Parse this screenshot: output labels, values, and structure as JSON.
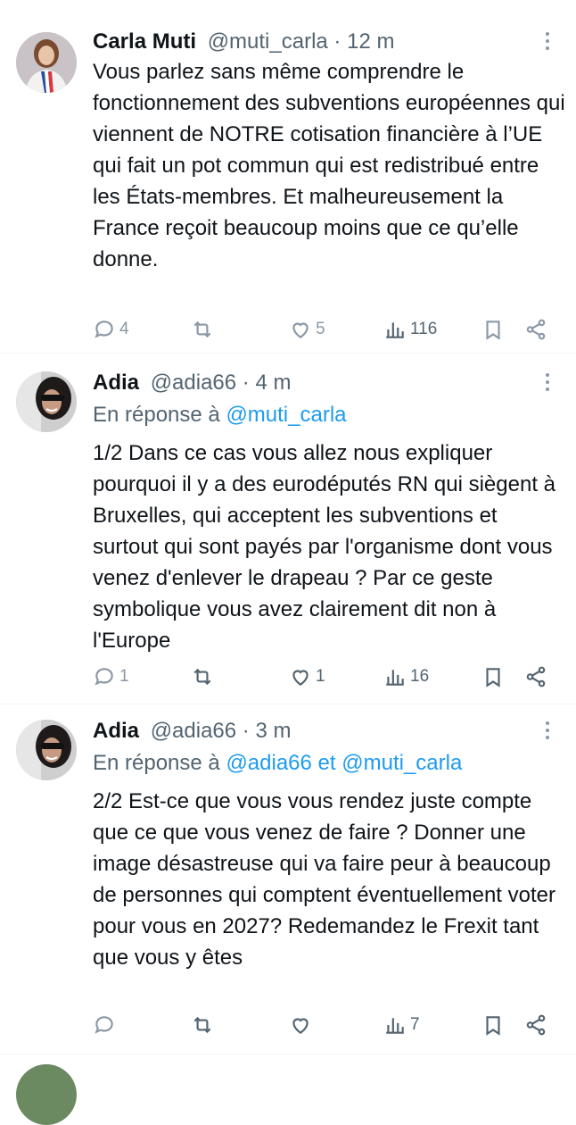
{
  "tweets": [
    {
      "name": "Carla Muti",
      "handle": "@muti_carla",
      "time": "12 m",
      "reply_prefix": "",
      "reply_links": [],
      "text": "Vous parlez sans même comprendre le fonctionnement des subventions européennes qui viennent de NOTRE cotisation financière à l’UE qui fait un pot commun qui est redistribué entre les États-membres. Et malheureusement la France reçoit beaucoup moins que ce qu’elle donne.",
      "replies": "4",
      "retweets": "",
      "likes": "5",
      "views": "116"
    },
    {
      "name": "Adia",
      "handle": "@adia66",
      "time": "4 m",
      "reply_prefix": "En réponse à ",
      "reply_links": [
        "@muti_carla"
      ],
      "text": "1/2 Dans ce cas vous allez nous expliquer pourquoi il y a des eurodéputés RN  qui siègent à Bruxelles, qui acceptent les subventions et surtout qui sont payés par l'organisme dont vous venez d'enlever le drapeau ? Par ce geste symbolique vous avez clairement dit non à l'Europe",
      "replies": "1",
      "retweets": "",
      "likes": "1",
      "views": "16"
    },
    {
      "name": "Adia",
      "handle": "@adia66",
      "time": "3 m",
      "reply_prefix": "En réponse à ",
      "reply_links": [
        "@adia66",
        "@muti_carla"
      ],
      "reply_joiner": " et ",
      "text": "2/2 Est-ce que vous vous rendez juste compte que ce que vous venez de faire ? Donner une image désastreuse qui va faire peur à beaucoup de personnes qui comptent éventuellement voter pour vous en 2027? Redemandez le Frexit tant que vous y êtes",
      "replies": "",
      "retweets": "",
      "likes": "",
      "views": "7"
    }
  ],
  "separator": " · ",
  "icons": {
    "reply": "reply-icon",
    "retweet": "retweet-icon",
    "like": "heart-icon",
    "views": "views-icon",
    "bookmark": "bookmark-icon",
    "share": "share-icon",
    "more": "more-icon"
  },
  "colors": {
    "link": "#1d9bf0",
    "muted": "#536471",
    "text": "#0f1419"
  }
}
